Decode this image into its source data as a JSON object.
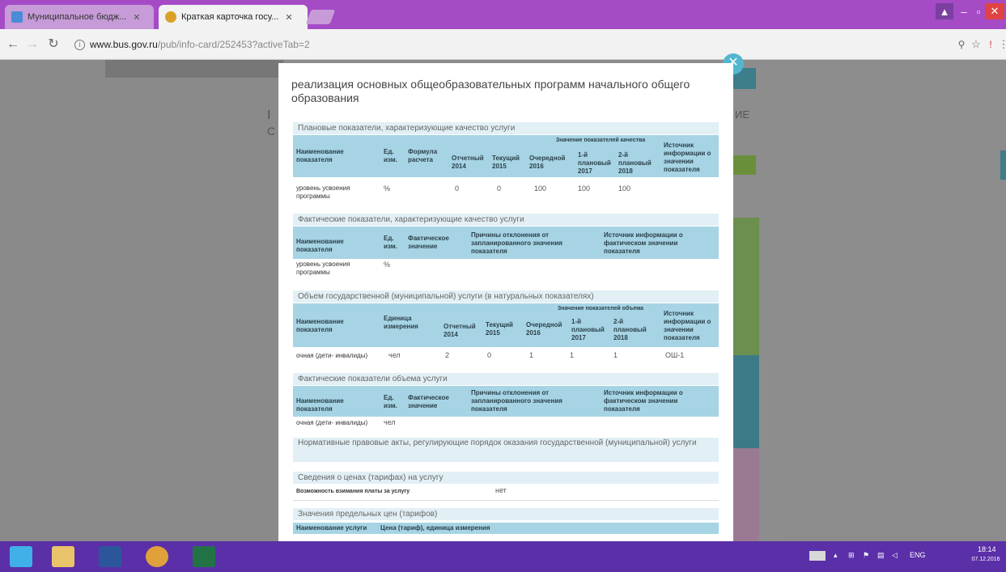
{
  "browser": {
    "tabs": [
      {
        "label": "Муниципальное бюдж...",
        "active": false
      },
      {
        "label": "Краткая карточка госу...",
        "active": true
      }
    ],
    "url_host": "www.bus.gov.ru",
    "url_path": "/pub/info-card/252453?activeTab=2"
  },
  "modal": {
    "title": "реализация основных общеобразовательных программ начального общего образования",
    "section1": {
      "heading": "Плановые показатели, характеризующие качество услуги",
      "group_header": "Значение показателей качества",
      "columns": [
        "Наименование показателя",
        "Ед. изм.",
        "Формула расчета",
        "Отчетный 2014",
        "Текущий 2015",
        "Очередной 2016",
        "1-й плановый 2017",
        "2-й плановый 2018",
        "Источник информации о значении показателя"
      ],
      "rows": [
        {
          "name": "уровень усвоения программы",
          "unit": "%",
          "values": [
            "0",
            "0",
            "100",
            "100",
            "100"
          ]
        }
      ]
    },
    "section2": {
      "heading": "Фактические показатели, характеризующие качество услуги",
      "columns": [
        "Наименование показателя",
        "Ед. изм.",
        "Фактическое значение",
        "Причины отклонения от запланированного значения показателя",
        "Источник информации о фактическом значении показателя"
      ],
      "rows": [
        {
          "name": "уровень усвоения программы",
          "unit": "%"
        }
      ]
    },
    "section3": {
      "heading": "Объем государственной (муниципальной) услуги (в натуральных показателях)",
      "group_header": "Значение показателей объема",
      "columns": [
        "Наименование показателя",
        "Единица измерения",
        "Отчетный 2014",
        "Текущий 2015",
        "Очередной 2016",
        "1-й плановый 2017",
        "2-й плановый 2018",
        "Источник информации о значении показателя"
      ],
      "rows": [
        {
          "name": "очная (дети- инвалиды)",
          "unit": "чел",
          "values": [
            "2",
            "0",
            "1",
            "1",
            "1"
          ],
          "source": "ОШ-1"
        }
      ]
    },
    "section4": {
      "heading": "Фактические показатели объема услуги",
      "columns": [
        "Наименование показателя",
        "Ед. изм.",
        "Фактическое значение",
        "Причины отклонения от запланированного значения показателя",
        "Источник информации о фактическом значении показателя"
      ],
      "rows": [
        {
          "name": "очная (дети- инвалиды)",
          "unit": "чел"
        }
      ]
    },
    "section5": {
      "heading": "Нормативные правовые акты, регулирующие порядок оказания государственной (муниципальной) услуги"
    },
    "section6": {
      "heading": "Сведения о ценах (тарифах) на услугу",
      "label": "Возможность взимания платы за услугу",
      "value": "нет"
    },
    "section7": {
      "heading": "Значения предельных цен (тарифов)",
      "columns": [
        "Наименование услуги",
        "Цена (тариф), единица измерения"
      ]
    }
  },
  "page": {
    "side_letter_1": "I",
    "side_letter_2": "C",
    "side_right_text": "ИЕ"
  },
  "taskbar": {
    "lang": "ENG",
    "time": "18:14",
    "date": "07.12.2016"
  }
}
